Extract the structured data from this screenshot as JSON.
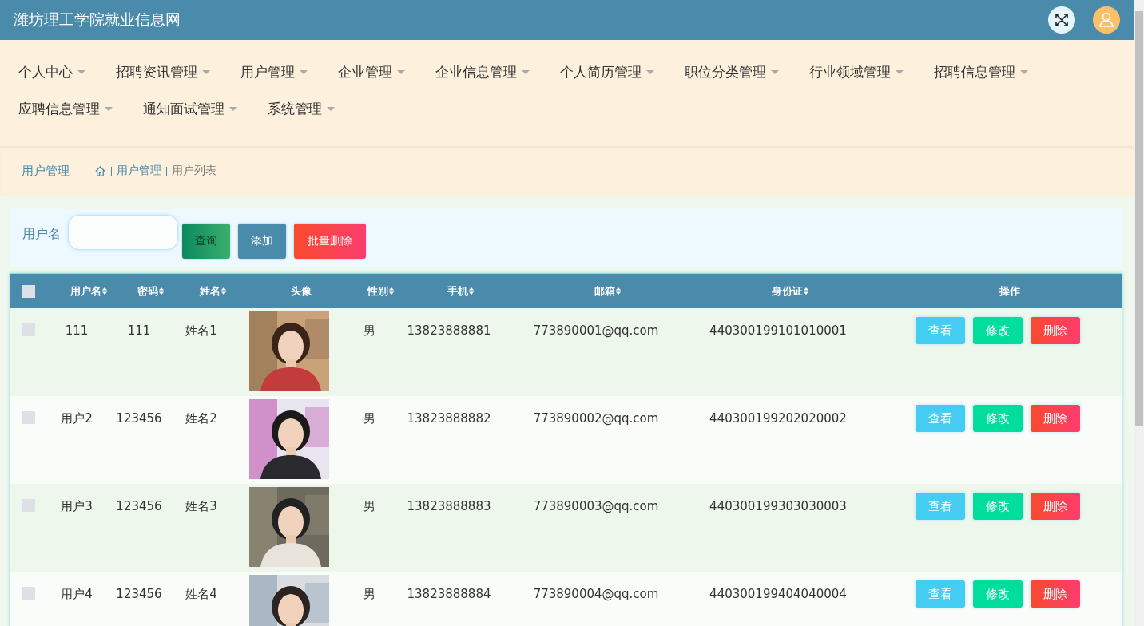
{
  "header": {
    "title": "潍坊理工学院就业信息网"
  },
  "nav": [
    {
      "label": "个人中心"
    },
    {
      "label": "招聘资讯管理"
    },
    {
      "label": "用户管理"
    },
    {
      "label": "企业管理"
    },
    {
      "label": "企业信息管理"
    },
    {
      "label": "个人简历管理"
    },
    {
      "label": "职位分类管理"
    },
    {
      "label": "行业领域管理"
    },
    {
      "label": "招聘信息管理"
    },
    {
      "label": "应聘信息管理"
    },
    {
      "label": "通知面试管理"
    },
    {
      "label": "系统管理"
    }
  ],
  "breadcrumb": {
    "title": "用户管理",
    "path": [
      "用户管理",
      "用户列表"
    ]
  },
  "search": {
    "label": "用户名",
    "buttons": [
      {
        "label": "查询",
        "kind": "search"
      },
      {
        "label": "添加",
        "kind": "add"
      },
      {
        "label": "批量删除",
        "kind": "delete"
      }
    ]
  },
  "table": {
    "select_all": {
      "checked": false
    },
    "columns": [
      {
        "label": "用户名",
        "sortable": true
      },
      {
        "label": "密码",
        "sortable": true
      },
      {
        "label": "姓名",
        "sortable": true
      },
      {
        "label": "头像",
        "sortable": false
      },
      {
        "label": "性别",
        "sortable": true
      },
      {
        "label": "手机",
        "sortable": true
      },
      {
        "label": "邮箱",
        "sortable": true
      },
      {
        "label": "身份证",
        "sortable": true
      },
      {
        "label": "操作",
        "sortable": false
      }
    ],
    "rows": [
      {
        "checked": false,
        "cells": [
          "111",
          "111",
          "姓名1",
          null,
          "男",
          "13823888881",
          "773890001@qq.com",
          "440300199101010001"
        ],
        "actions": [
          "查看",
          "修改",
          "删除"
        ]
      },
      {
        "checked": false,
        "cells": [
          "用户2",
          "123456",
          "姓名2",
          null,
          "男",
          "13823888882",
          "773890002@qq.com",
          "440300199202020002"
        ],
        "actions": [
          "查看",
          "修改",
          "删除"
        ]
      },
      {
        "checked": false,
        "cells": [
          "用户3",
          "123456",
          "姓名3",
          null,
          "男",
          "13823888883",
          "773890003@qq.com",
          "440300199303030003"
        ],
        "actions": [
          "查看",
          "修改",
          "删除"
        ]
      },
      {
        "checked": false,
        "cells": [
          "用户4",
          "123456",
          "姓名4",
          null,
          "男",
          "13823888884",
          "773890004@qq.com",
          "440300199404040004"
        ],
        "actions": [
          "查看",
          "修改",
          "删除"
        ]
      }
    ]
  }
}
